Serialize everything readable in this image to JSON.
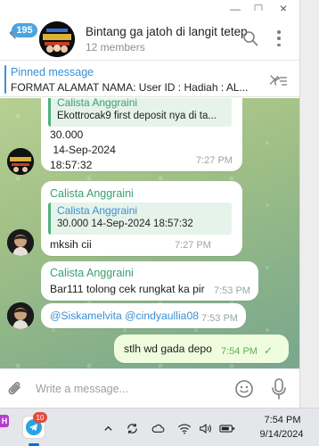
{
  "window": {
    "minimize_glyph": "—",
    "maximize_glyph": "☐",
    "close_glyph": "✕"
  },
  "header": {
    "unread_count": "195",
    "title": "Bintang ga jatoh di langit tetep",
    "members": "12 members",
    "icons": [
      "back-arrow-icon",
      "search-icon",
      "more-vertical-icon"
    ]
  },
  "pinned": {
    "label": "Pinned message",
    "text": "FORMAT ALAMAT NAMA:  User ID  :  Hadiah :   AL...",
    "icon": "pin-list-icon"
  },
  "messages": [
    {
      "reply_sender": "Calista Anggraini",
      "reply_text": "Ekottrocak9 first deposit nya di ta...",
      "text": "30.000\n 14-Sep-2024\n18:57:32",
      "time": "7:27 PM"
    },
    {
      "sender": "Calista Anggraini",
      "reply_sender": "Calista Anggraini",
      "reply_text": "30.000  14-Sep-2024 18:57:32",
      "text": "mksih cii",
      "time": "7:27 PM"
    },
    {
      "sender": "Calista Anggraini",
      "text": "Bar111 tolong cek rungkat ka pir",
      "time": "7:53 PM"
    },
    {
      "text": "@Siskamelvita @cindyaullia08",
      "time": "7:53 PM"
    },
    {
      "text": "stlh wd gada depo",
      "time": "7:54 PM",
      "outgoing": true,
      "status_glyph": "✓"
    }
  ],
  "composer": {
    "placeholder": "Write a message..."
  },
  "taskbar": {
    "left_app_letter": "H",
    "telegram_badge": "10",
    "clock_time": "7:54 PM",
    "clock_date": "9/14/2024",
    "tray_icons": [
      "chevron-up-icon",
      "sync-icon",
      "cloud-icon",
      "wifi-icon",
      "speaker-icon",
      "battery-icon"
    ]
  },
  "colors": {
    "accent": "#3a91d6",
    "sender_name": "#3aa071",
    "outgoing_bubble": "#effdde"
  }
}
